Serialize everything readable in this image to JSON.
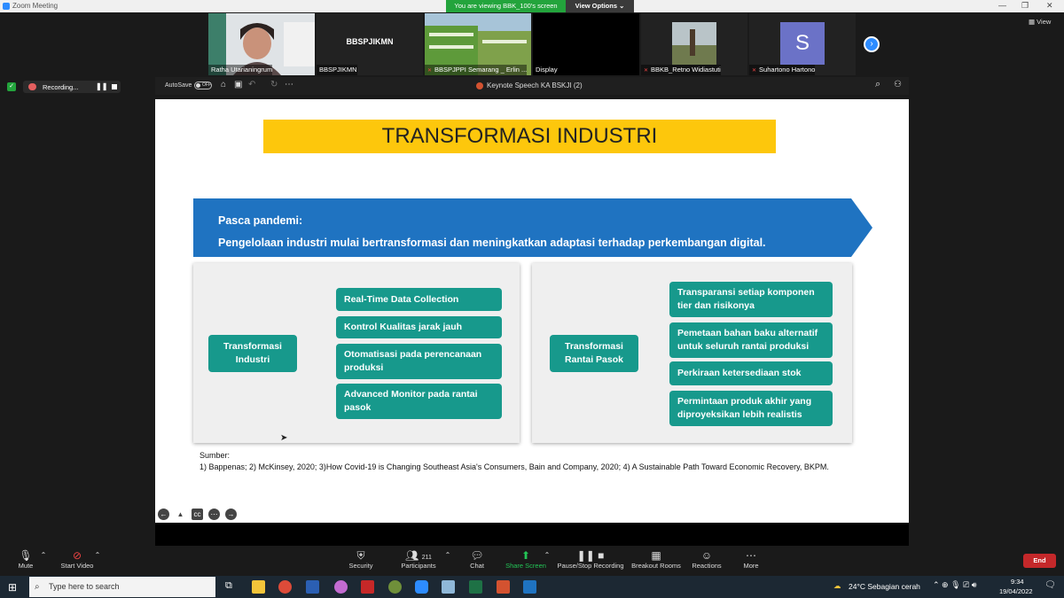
{
  "window": {
    "title": "Zoom Meeting"
  },
  "viewing": {
    "text": "You are viewing BBK_100's screen",
    "options": "View Options ⌄"
  },
  "participants_strip": {
    "tiles": [
      {
        "name": "Ratha Utarianingrum",
        "bg": "#d9d9d9",
        "muted": false
      },
      {
        "big": "BBSPJIKMN",
        "name": "BBSPJIKMN",
        "bg": "#222222",
        "muted": false
      },
      {
        "name": "BBSPJPPI Semarang _ Erlin ...",
        "bg": "#4f8a3c",
        "muted": true
      },
      {
        "name": "Display",
        "bg": "#000000",
        "muted": false
      },
      {
        "name": "BBKB_Retno Widiastuti",
        "bg": "#8a8a7a",
        "muted": true
      },
      {
        "avatar_letter": "S",
        "name": "Suhartono Hartono",
        "bg": "#222222",
        "muted": true
      }
    ],
    "view_label": "View"
  },
  "recording": {
    "label": "Recording..."
  },
  "keynote": {
    "autosave": "AutoSave",
    "off": "OFF",
    "doc_title": "Keynote Speech KA BSKJI (2)"
  },
  "slide": {
    "title": "TRANSFORMASI INDUSTRI",
    "banner_line1": "Pasca pandemi:",
    "banner_line2": "Pengelolaan industri mulai bertransformasi dan meningkatkan adaptasi terhadap perkembangan digital.",
    "left_panel": {
      "hub": "Transformasi Industri",
      "items": [
        "Real-Time Data Collection",
        "Kontrol Kualitas jarak jauh",
        "Otomatisasi pada perencanaan produksi",
        "Advanced Monitor pada rantai pasok"
      ]
    },
    "right_panel": {
      "hub": "Transformasi Rantai Pasok",
      "items": [
        "Transparansi setiap komponen tier dan risikonya",
        "Pemetaan bahan baku alternatif untuk seluruh rantai produksi",
        "Perkiraan ketersediaan stok",
        "Permintaan produk akhir yang diproyeksikan lebih realistis"
      ]
    },
    "sources_label": "Sumber:",
    "sources_text": "1) Bappenas; 2) McKinsey, 2020; 3)How Covid-19 is Changing Southeast Asia's Consumers, Bain and Company, 2020; 4) A Sustainable Path Toward Economic Recovery, BKPM."
  },
  "toolbar": {
    "mute": "Mute",
    "start_video": "Start Video",
    "security": "Security",
    "participants": "Participants",
    "participants_count": "211",
    "chat": "Chat",
    "share_screen": "Share Screen",
    "pause_recording": "Pause/Stop Recording",
    "breakout": "Breakout Rooms",
    "reactions": "Reactions",
    "more": "More",
    "end": "End"
  },
  "taskbar": {
    "search_placeholder": "Type here to search",
    "weather": "24°C  Sebagian cerah",
    "time": "9:34",
    "date": "19/04/2022"
  },
  "colors": {
    "teal": "#17998c",
    "banner_blue": "#1f73c1",
    "title_yellow": "#fdc70c",
    "zoom_blue": "#2d8cff",
    "share_green": "#23a43c",
    "end_red": "#c4282a"
  }
}
